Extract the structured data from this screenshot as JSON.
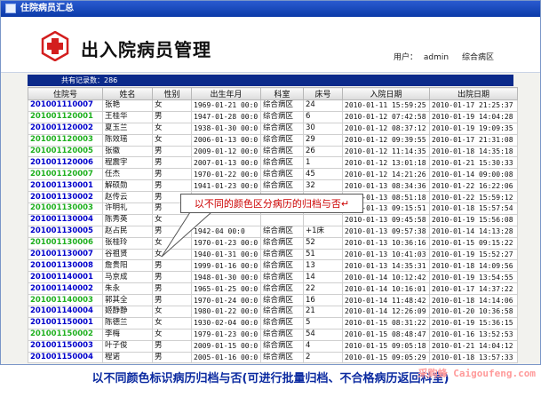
{
  "window": {
    "title": "住院病员汇总"
  },
  "header": {
    "app_title": "出入院病员管理",
    "user_label": "用户：",
    "user_name": "admin",
    "ward": "综合病区"
  },
  "count_bar": {
    "text": "共有记录数：286"
  },
  "columns": [
    "住院号",
    "姓名",
    "性别",
    "出生年月",
    "科室",
    "床号",
    "入院日期",
    "出院日期"
  ],
  "colors": {
    "blue": "#0000cc",
    "green": "#1fb01f"
  },
  "rows": [
    {
      "no": "201001110007",
      "color": "blue",
      "name": "张艳",
      "sex": "女",
      "birth": "1969-01-21 00:0",
      "dept": "综合病区",
      "bed": "24",
      "admit": "2010-01-11 15:59:25",
      "discharge": "2010-01-17 21:25:37"
    },
    {
      "no": "201001120001",
      "color": "green",
      "name": "王桂华",
      "sex": "男",
      "birth": "1947-01-28 00:0",
      "dept": "综合病区",
      "bed": "6",
      "admit": "2010-01-12 07:42:58",
      "discharge": "2010-01-19 14:04:28"
    },
    {
      "no": "201001120002",
      "color": "blue",
      "name": "夏玉兰",
      "sex": "女",
      "birth": "1938-01-30 00:0",
      "dept": "综合病区",
      "bed": "30",
      "admit": "2010-01-12 08:37:12",
      "discharge": "2010-01-19 19:09:35"
    },
    {
      "no": "201001120003",
      "color": "green",
      "name": "陈效瑶",
      "sex": "女",
      "birth": "2006-01-13 00:0",
      "dept": "综合病区",
      "bed": "29",
      "admit": "2010-01-12 09:39:55",
      "discharge": "2010-01-17 21:31:08"
    },
    {
      "no": "201001120005",
      "color": "green",
      "name": "张徽",
      "sex": "男",
      "birth": "2009-01-12 00:0",
      "dept": "综合病区",
      "bed": "26",
      "admit": "2010-01-12 11:14:35",
      "discharge": "2010-01-18 14:35:18"
    },
    {
      "no": "201001120006",
      "color": "blue",
      "name": "程震宇",
      "sex": "男",
      "birth": "2007-01-13 00:0",
      "dept": "综合病区",
      "bed": "1",
      "admit": "2010-01-12 13:01:18",
      "discharge": "2010-01-21 15:30:33"
    },
    {
      "no": "201001120007",
      "color": "green",
      "name": "任杰",
      "sex": "男",
      "birth": "1970-01-22 00:0",
      "dept": "综合病区",
      "bed": "45",
      "admit": "2010-01-12 14:21:26",
      "discharge": "2010-01-14 09:00:08"
    },
    {
      "no": "201001130001",
      "color": "blue",
      "name": "解硕勋",
      "sex": "男",
      "birth": "1941-01-23 00:0",
      "dept": "综合病区",
      "bed": "32",
      "admit": "2010-01-13 08:34:36",
      "discharge": "2010-01-22 16:22:06"
    },
    {
      "no": "201001130002",
      "color": "blue",
      "name": "赵传云",
      "sex": "男",
      "birth": "",
      "dept": "",
      "bed": "",
      "admit": "2010-01-13 08:51:18",
      "discharge": "2010-01-22 15:59:12"
    },
    {
      "no": "201001130003",
      "color": "green",
      "name": "许明礼",
      "sex": "男",
      "birth": "",
      "dept": "",
      "bed": "",
      "admit": "2010-01-13 09:15:51",
      "discharge": "2010-01-18 15:57:54"
    },
    {
      "no": "201001130004",
      "color": "blue",
      "name": "陈秀英",
      "sex": "女",
      "birth": "",
      "dept": "",
      "bed": "",
      "admit": "2010-01-13 09:45:58",
      "discharge": "2010-01-19 15:56:08"
    },
    {
      "no": "201001130005",
      "color": "blue",
      "name": "赵占民",
      "sex": "男",
      "birth": "1942-04 00:0",
      "dept": "综合病区",
      "bed": "+1床",
      "admit": "2010-01-13 09:57:38",
      "discharge": "2010-01-14 14:13:28"
    },
    {
      "no": "201001130006",
      "color": "green",
      "name": "张桂玲",
      "sex": "女",
      "birth": "1970-01-23 00:0",
      "dept": "综合病区",
      "bed": "52",
      "admit": "2010-01-13 10:36:16",
      "discharge": "2010-01-15 09:15:22"
    },
    {
      "no": "201001130007",
      "color": "blue",
      "name": "谷祖贤",
      "sex": "女",
      "birth": "1940-01-31 00:0",
      "dept": "综合病区",
      "bed": "51",
      "admit": "2010-01-13 10:41:03",
      "discharge": "2010-01-19 15:52:27"
    },
    {
      "no": "201001130008",
      "color": "blue",
      "name": "詹贵阳",
      "sex": "男",
      "birth": "1999-01-16 00:0",
      "dept": "综合病区",
      "bed": "13",
      "admit": "2010-01-13 14:35:31",
      "discharge": "2010-01-18 14:09:56"
    },
    {
      "no": "201001140001",
      "color": "blue",
      "name": "马京成",
      "sex": "男",
      "birth": "1948-01-30 00:0",
      "dept": "综合病区",
      "bed": "14",
      "admit": "2010-01-14 10:12:42",
      "discharge": "2010-01-19 13:54:55"
    },
    {
      "no": "201001140002",
      "color": "blue",
      "name": "朱永",
      "sex": "男",
      "birth": "1965-01-25 00:0",
      "dept": "综合病区",
      "bed": "22",
      "admit": "2010-01-14 10:16:01",
      "discharge": "2010-01-17 14:37:22"
    },
    {
      "no": "201001140003",
      "color": "green",
      "name": "郭其全",
      "sex": "男",
      "birth": "1970-01-24 00:0",
      "dept": "综合病区",
      "bed": "16",
      "admit": "2010-01-14 11:48:42",
      "discharge": "2010-01-18 14:14:06"
    },
    {
      "no": "201001140004",
      "color": "blue",
      "name": "姬静静",
      "sex": "女",
      "birth": "1980-01-22 00:0",
      "dept": "综合病区",
      "bed": "21",
      "admit": "2010-01-14 12:26:09",
      "discharge": "2010-01-20 10:36:58"
    },
    {
      "no": "201001150001",
      "color": "blue",
      "name": "陈德兰",
      "sex": "女",
      "birth": "1930-02-04 00:0",
      "dept": "综合病区",
      "bed": "5",
      "admit": "2010-01-15 08:31:22",
      "discharge": "2010-01-19 15:36:15"
    },
    {
      "no": "201001150002",
      "color": "green",
      "name": "李梅",
      "sex": "女",
      "birth": "1979-01-23 00:0",
      "dept": "综合病区",
      "bed": "54",
      "admit": "2010-01-15 08:48:47",
      "discharge": "2010-01-16 13:52:53"
    },
    {
      "no": "201001150003",
      "color": "blue",
      "name": "叶子俊",
      "sex": "男",
      "birth": "2009-01-15 00:0",
      "dept": "综合病区",
      "bed": "4",
      "admit": "2010-01-15 09:05:18",
      "discharge": "2010-01-21 14:04:12"
    },
    {
      "no": "201001150004",
      "color": "blue",
      "name": "程诺",
      "sex": "男",
      "birth": "2005-01-16 00:0",
      "dept": "综合病区",
      "bed": "2",
      "admit": "2010-01-15 09:05:29",
      "discharge": "2010-01-18 13:57:33"
    }
  ],
  "callout": {
    "text": "以不同的颜色区分病历的归档与否↵"
  },
  "caption": {
    "text": "以不同颜色标识病历归档与否(可进行批量归档、不合格病历返回科室)"
  },
  "watermark": {
    "text": "采购蜂 Caigoufeng.com"
  }
}
